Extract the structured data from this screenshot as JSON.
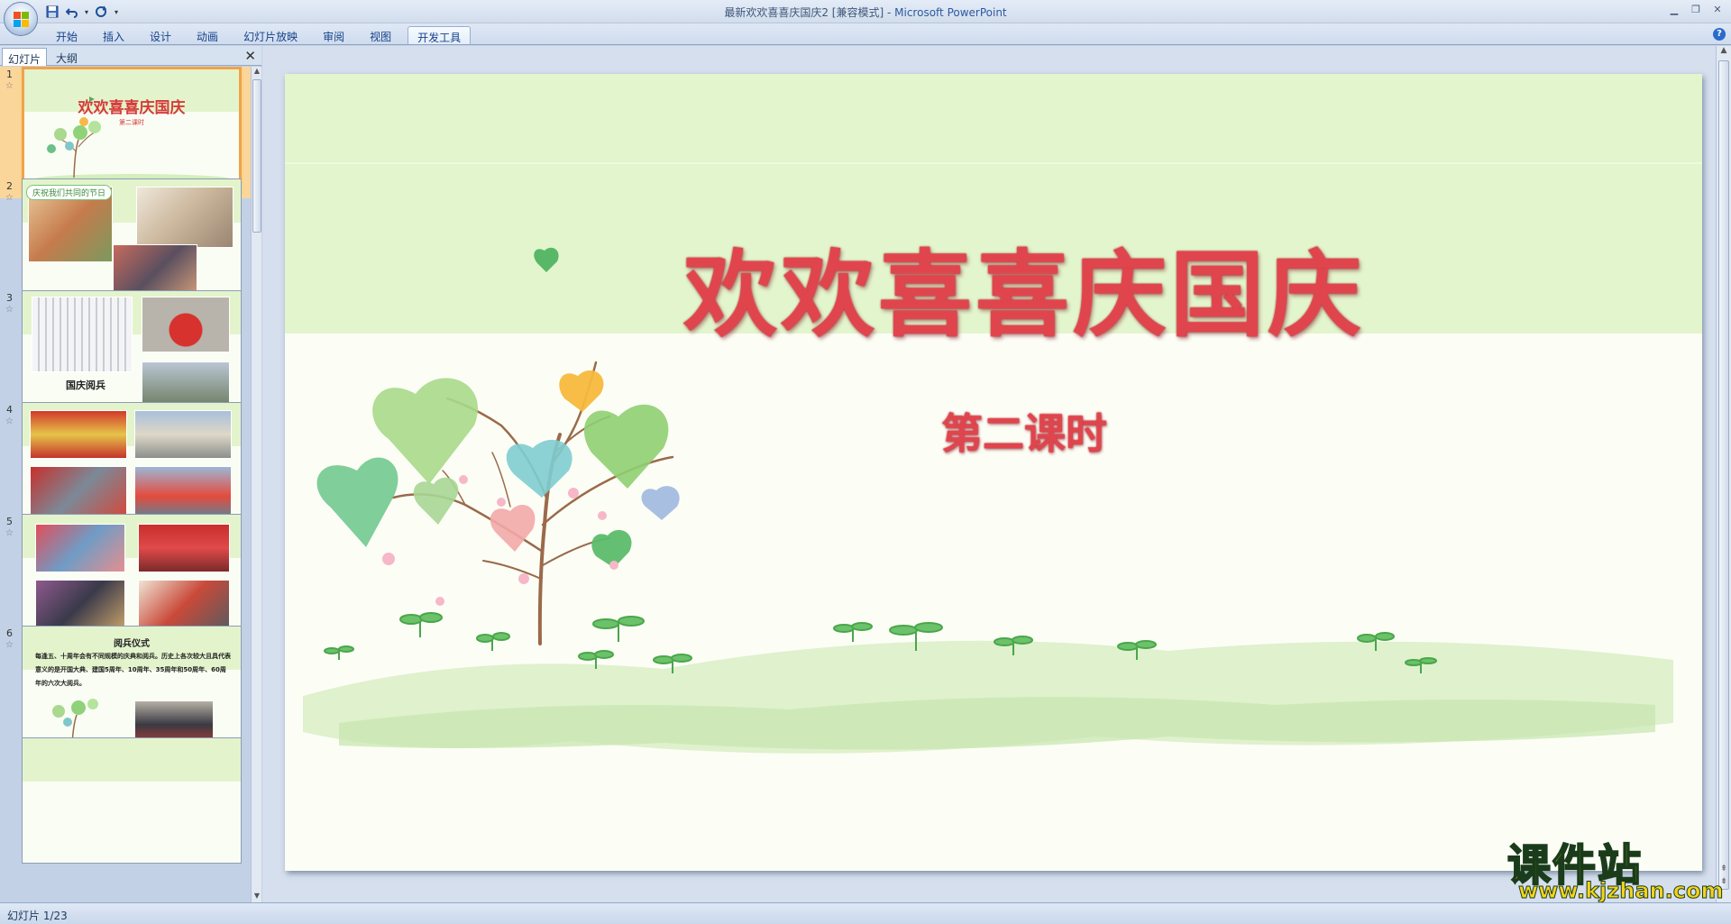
{
  "window": {
    "title": "最新欢欢喜喜庆国庆2 [兼容模式] - ",
    "app_name": "Microsoft PowerPoint"
  },
  "qat": {
    "items": [
      "save-icon",
      "undo-icon",
      "redo-icon",
      "customize-icon"
    ]
  },
  "ribbon": {
    "tabs": [
      {
        "label": "开始",
        "active": false
      },
      {
        "label": "插入",
        "active": false
      },
      {
        "label": "设计",
        "active": false
      },
      {
        "label": "动画",
        "active": false
      },
      {
        "label": "幻灯片放映",
        "active": false
      },
      {
        "label": "审阅",
        "active": false
      },
      {
        "label": "视图",
        "active": false
      },
      {
        "label": "开发工具",
        "active": true
      }
    ],
    "help": "?"
  },
  "panel": {
    "tab_slides": "幻灯片",
    "tab_outline": "大纲",
    "close": "✕"
  },
  "thumbnails": [
    {
      "num": "1",
      "title": "欢欢喜喜庆国庆",
      "subtitle": "第二课时",
      "selected": true
    },
    {
      "num": "2",
      "pill": "庆祝我们共同的节日",
      "selected": false
    },
    {
      "num": "3",
      "label": "国庆阅兵",
      "selected": false
    },
    {
      "num": "4",
      "selected": false
    },
    {
      "num": "5",
      "selected": false
    },
    {
      "num": "6",
      "heading": "阅兵仪式",
      "body": "每逢五、十周年会有不同规模的庆典和阅兵。历史上各次较大且具代表意义的是开国大典、建国5周年、10周年、35周年和50周年、60周年的六次大阅兵。",
      "selected": false
    }
  ],
  "slide": {
    "title": "欢欢喜喜庆国庆",
    "subtitle": "第二课时"
  },
  "watermark": {
    "text": "课件站",
    "url": "www.kjzhan.com"
  },
  "status": {
    "slide_indicator": "幻灯片 1/23"
  },
  "colors": {
    "title_red": "#e0454d",
    "band_green": "#e2f5cc",
    "slide_bg": "#fcfef6",
    "selection_orange": "#f2a24a",
    "watermark_yellow": "#f5d31c"
  }
}
